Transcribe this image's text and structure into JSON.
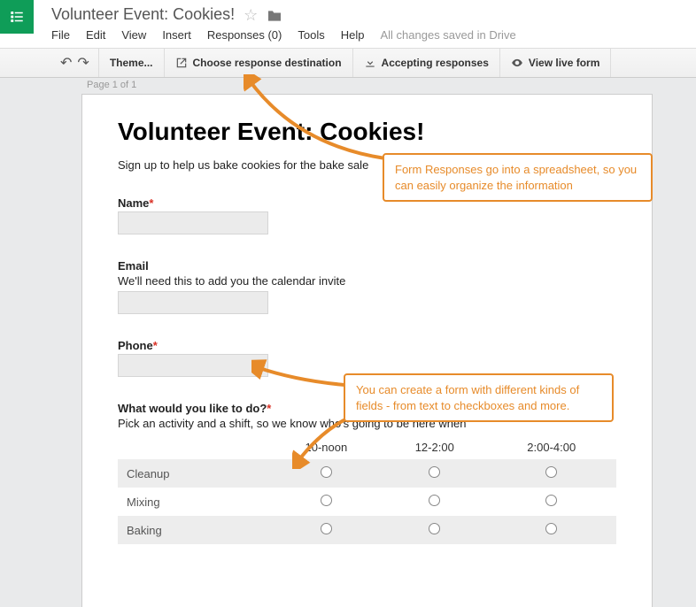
{
  "header": {
    "doc_title": "Volunteer Event: Cookies!"
  },
  "menu": {
    "file": "File",
    "edit": "Edit",
    "view": "View",
    "insert": "Insert",
    "responses": "Responses (0)",
    "tools": "Tools",
    "help": "Help",
    "save_status": "All changes saved in Drive"
  },
  "toolbar": {
    "theme": "Theme...",
    "choose_dest": "Choose response destination",
    "accepting": "Accepting responses",
    "view_live": "View live form"
  },
  "page_info": "Page 1 of 1",
  "form": {
    "title": "Volunteer Event: Cookies!",
    "description": "Sign up to help us bake cookies for the bake sale",
    "name": {
      "label": "Name"
    },
    "email": {
      "label": "Email",
      "help": "We'll need this to add you the calendar invite"
    },
    "phone": {
      "label": "Phone"
    },
    "activity": {
      "label": "What would you like to do?",
      "help": "Pick an activity and a shift, so we know who's going to be here when",
      "cols": [
        "10-noon",
        "12-2:00",
        "2:00-4:00"
      ],
      "rows": [
        "Cleanup",
        "Mixing",
        "Baking"
      ]
    }
  },
  "callouts": {
    "c1": "Form Responses go into a spreadsheet, so you can easily organize the information",
    "c2": "You can create a form with different kinds of fields - from text to checkboxes and more."
  }
}
